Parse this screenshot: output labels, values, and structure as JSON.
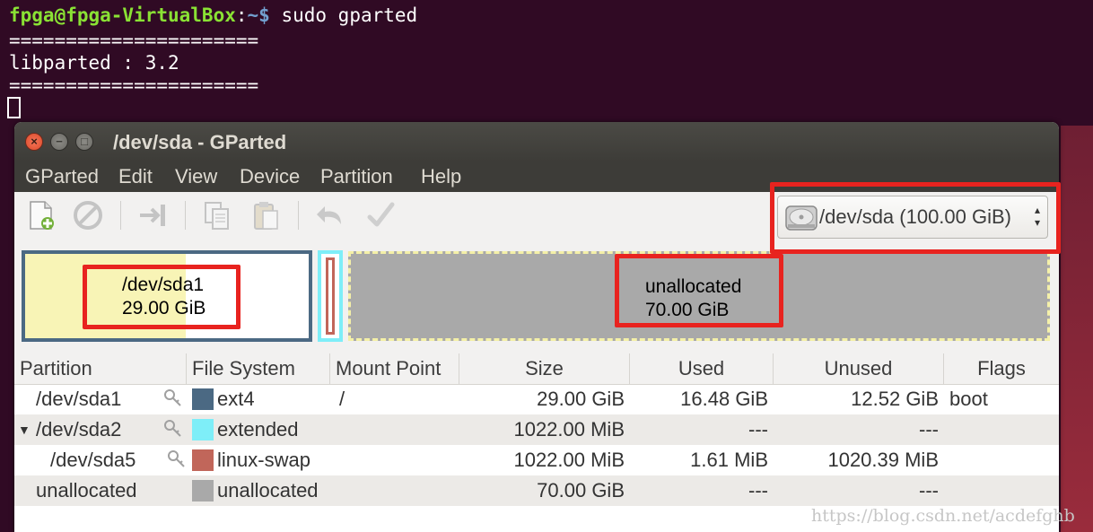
{
  "terminal": {
    "prompt_user": "fpga@fpga-VirtualBox",
    "prompt_sep": ":",
    "prompt_path": "~$",
    "command": " sudo gparted",
    "line_sep1": "======================",
    "line_lib": "libparted : 3.2",
    "line_sep2": "======================"
  },
  "window": {
    "title": "/dev/sda - GParted",
    "close_glyph": "×",
    "min_glyph": "−",
    "max_glyph": "□"
  },
  "menu": {
    "items": [
      "GParted",
      "Edit",
      "View",
      "Device",
      "Partition",
      "Help"
    ]
  },
  "toolbar": {
    "buttons": [
      "new-partition",
      "delete-partition",
      "resize-move",
      "copy",
      "paste",
      "undo",
      "apply"
    ]
  },
  "device_selector": {
    "value": "/dev/sda  (100.00 GiB)",
    "arrows": "▲\n▼"
  },
  "diskmap": {
    "sda1_name": "/dev/sda1",
    "sda1_size": "29.00 GiB",
    "sda1_used_fraction": 0.568,
    "unalloc_name": "unallocated",
    "unalloc_size": "70.00 GiB"
  },
  "table": {
    "headers": [
      "Partition",
      "File System",
      "Mount Point",
      "Size",
      "Used",
      "Unused",
      "Flags"
    ],
    "rows": [
      {
        "partition": "/dev/sda1",
        "fs": "ext4",
        "fs_color": "#4b6983",
        "mount": "/",
        "size": "29.00 GiB",
        "used": "16.48 GiB",
        "unused": "12.52 GiB",
        "flags": "boot"
      },
      {
        "partition": "/dev/sda2",
        "fs": "extended",
        "fs_color": "#7eeef8",
        "mount": "",
        "size": "1022.00 MiB",
        "used": "---",
        "unused": "---",
        "flags": ""
      },
      {
        "partition": "/dev/sda5",
        "fs": "linux-swap",
        "fs_color": "#c1665a",
        "mount": "",
        "size": "1022.00 MiB",
        "used": "1.61 MiB",
        "unused": "1020.39 MiB",
        "flags": ""
      },
      {
        "partition": "unallocated",
        "fs": "unallocated",
        "fs_color": "#a9a9a9",
        "mount": "",
        "size": "70.00 GiB",
        "used": "---",
        "unused": "---",
        "flags": ""
      }
    ]
  },
  "watermark": "https://blog.csdn.net/acdefghb",
  "colors": {
    "terminal_bg": "#300a24",
    "highlight_red": "#e8231f",
    "ext4": "#4b6983",
    "extended": "#7eeef8",
    "swap": "#c1665a",
    "unallocated": "#a9a9a9"
  }
}
